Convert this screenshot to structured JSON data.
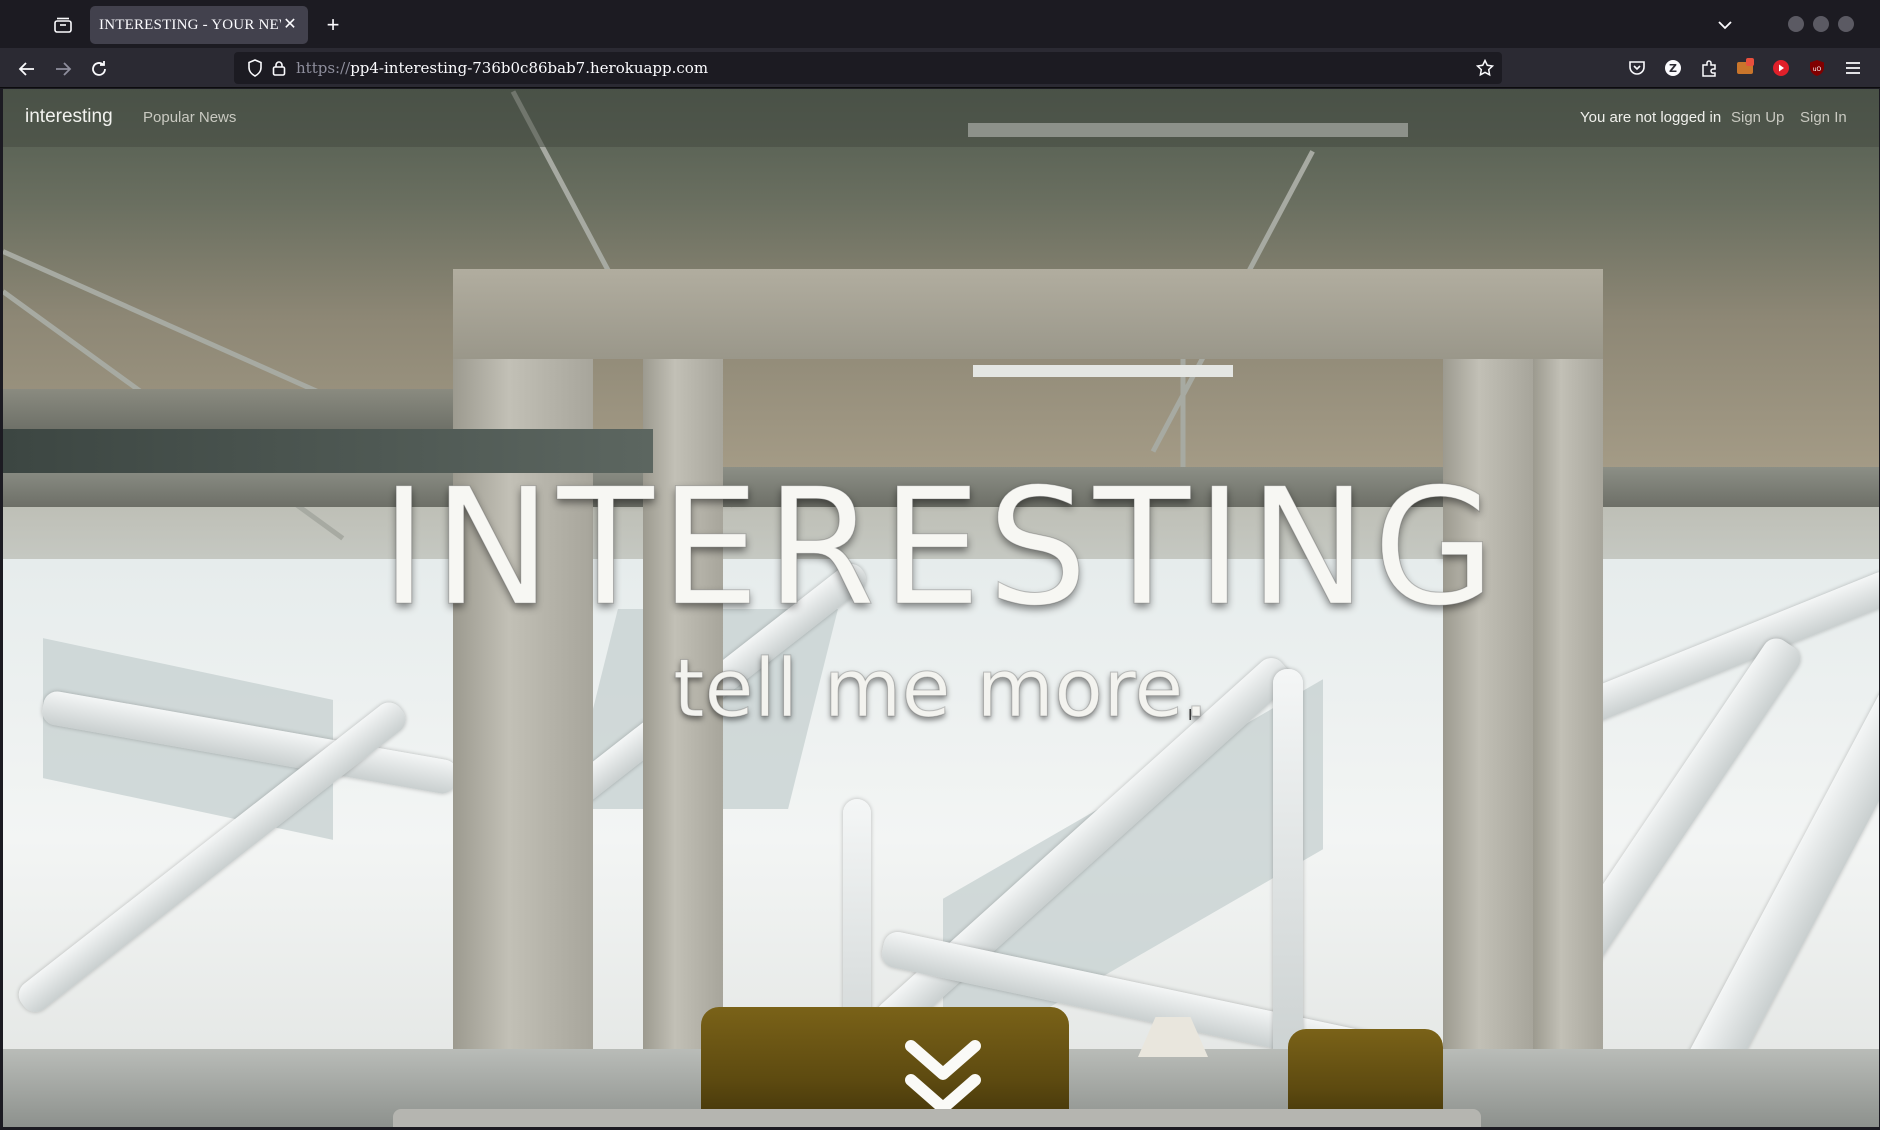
{
  "browser": {
    "tab_title": "INTERESTING - YOUR NEWS",
    "url_scheme": "https://",
    "url_host": "pp4-interesting-736b0c86bab7.herokuapp.com"
  },
  "site": {
    "brand": "interesting",
    "nav_popular": "Popular News",
    "login_status": "You are not logged in",
    "sign_up": "Sign Up",
    "sign_in": "Sign In"
  },
  "hero": {
    "title": "INTERESTING",
    "subtitle": "tell me more."
  },
  "icons": {
    "tab_overview": "tab-overview-icon",
    "close": "close-icon",
    "new_tab": "plus-icon",
    "tab_list": "chevron-down-icon",
    "back": "back-arrow-icon",
    "forward": "forward-arrow-icon",
    "reload": "reload-icon",
    "shield": "tracking-shield-icon",
    "lock": "lock-icon",
    "bookmark": "star-icon",
    "pocket": "pocket-icon",
    "extensions": "puzzle-icon",
    "menu": "hamburger-menu-icon",
    "scroll": "double-chevron-down-icon"
  },
  "colors": {
    "chrome_bg": "#1c1b22",
    "toolbar_bg": "#2b2a33",
    "tab_active": "#42414d",
    "hero_text": "#f7f7f3"
  }
}
